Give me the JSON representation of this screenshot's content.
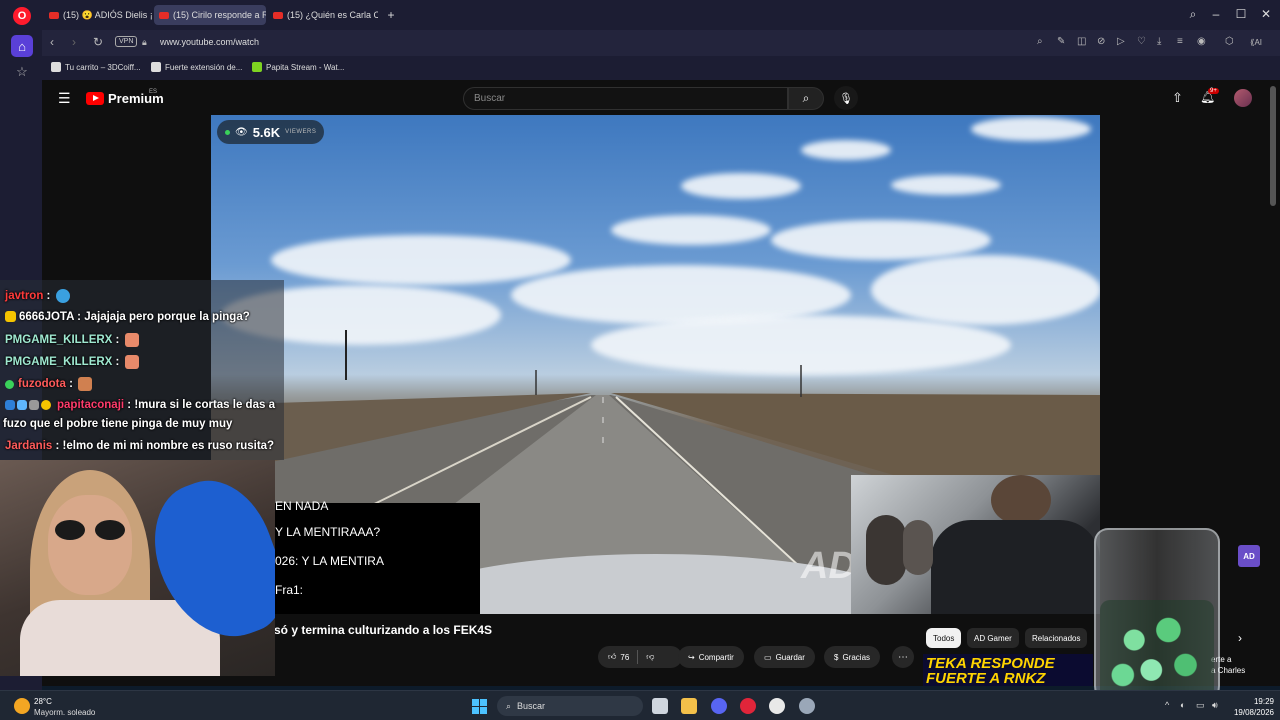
{
  "browser": {
    "tabs": [
      {
        "label": "(15) 😮 ADIÓS Dielis ¡FE"
      },
      {
        "label": "(15) Cirilo responde a Ron"
      },
      {
        "label": "(15) ¿Quién es Carla Camp"
      }
    ],
    "new_tab_symbol": "+",
    "url": "www.youtube.com/watch",
    "vpn_label": "VPN",
    "ai_label": "AI",
    "bookmarks": [
      {
        "label": "Tu carrito – 3DCoiff..."
      },
      {
        "label": "Fuerte extensión de..."
      },
      {
        "label": "Papita Stream - Wat..."
      }
    ]
  },
  "youtube": {
    "logo_text": "Premium",
    "region": "ES",
    "search_placeholder": "Buscar",
    "notification_badge": "9+",
    "viewers_count": "5.6K",
    "viewers_label": "VIEWERS",
    "watermark": "AD",
    "caption_lines": [
      "EN NADA",
      "Y LA MENTIRAAA?",
      "026: Y LA MENTIRA",
      "Fra1:"
    ],
    "video_title": "só y termina culturizando a los FEK4S",
    "actions": {
      "likes": "76",
      "share": "Compartir",
      "save": "Guardar",
      "thanks": "Gracias",
      "more": "⋯"
    },
    "chips": [
      {
        "label": "Todos",
        "active": true
      },
      {
        "label": "AD Gamer",
        "active": false
      },
      {
        "label": "Relacionados",
        "active": false
      }
    ],
    "thumbnail_text": [
      "TEKA RESPONDE",
      "FUERTE A RNKZ"
    ],
    "side_text": [
      "erte a",
      "a Charles"
    ],
    "ad_badge": "AD"
  },
  "chat": {
    "messages": [
      {
        "user": "javtron",
        "color": "#ff3b3b",
        "text": "",
        "emote": "#3aa0e0"
      },
      {
        "user": "6666JOTA",
        "color": "#ffffff",
        "text": "Jajajaja pero porque la pinga?",
        "emote": ""
      },
      {
        "user": "PMGAME_KILLERX",
        "color": "#9fe8d0",
        "text": "",
        "emote": "#e88a6a"
      },
      {
        "user": "PMGAME_KILLERX",
        "color": "#9fe8d0",
        "text": "",
        "emote": "#e88a6a"
      },
      {
        "user": "fuzodota",
        "color": "#ff5b5b",
        "text": "",
        "emote": "#d08050"
      },
      {
        "user": "papitaconaji",
        "color": "#ff3b6b",
        "text": "!mura si le cortas le das a",
        "emote": ""
      },
      {
        "user": "",
        "color": "#ffffff",
        "text": "fuzo que el pobre tiene pinga de muy muy",
        "emote": ""
      },
      {
        "user": "Jardanis",
        "color": "#ff5b5b",
        "text": "!elmo de mi mi nombre es ruso rusita?",
        "emote": ""
      }
    ]
  },
  "taskbar": {
    "temperature": "28°C",
    "weather": "Mayorm. soleado",
    "search_label": "Buscar",
    "time": "19:29",
    "date": "19/08/2026",
    "apps": [
      {
        "name": "task-view",
        "color": "#cfd6df"
      },
      {
        "name": "file-explorer",
        "color": "#f3c04a"
      },
      {
        "name": "discord",
        "color": "#5865f2"
      },
      {
        "name": "opera",
        "color": "#e0253a"
      },
      {
        "name": "chatgpt",
        "color": "#e8e8e8"
      },
      {
        "name": "settings",
        "color": "#9aa7b8"
      }
    ]
  },
  "colors": {
    "youtube_red": "#ff0000",
    "opera_red": "#ff1b2d",
    "accent": "#4cc2ff"
  }
}
